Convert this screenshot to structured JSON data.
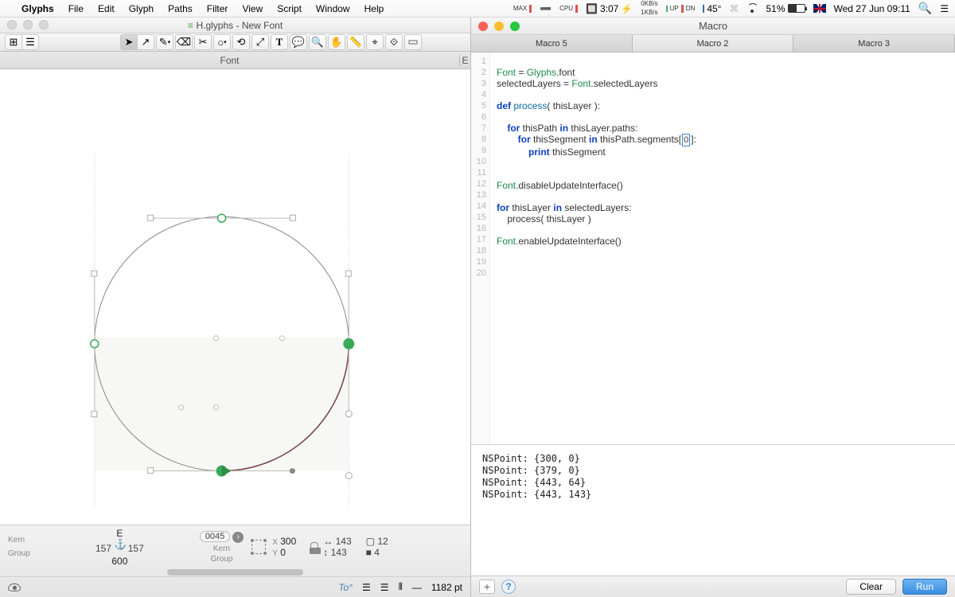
{
  "menubar": {
    "app": "Glyphs",
    "items": [
      "File",
      "Edit",
      "Glyph",
      "Paths",
      "Filter",
      "View",
      "Script",
      "Window",
      "Help"
    ],
    "net_up": "0KB/s",
    "net_down": "1KB/s",
    "time1": "3:07",
    "temp": "45°",
    "batt": "51%",
    "date": "Wed 27 Jun  09:11"
  },
  "glyphs": {
    "title": "H.glyphs - New Font",
    "titlebar_marker": "≡",
    "tab": "Font",
    "tab_right": "E",
    "info": {
      "glyph": "E",
      "unicode": "0045",
      "kern": "Kern",
      "kern_l": "157",
      "kern_r": "157",
      "group": "Group",
      "width": "600",
      "x": "X",
      "x_val": "300",
      "y": "Y",
      "y_val": "0",
      "dx": "143",
      "dy": "143",
      "w": "12",
      "h": "4"
    },
    "status": {
      "zoom": "1182 pt",
      "to": "To"
    }
  },
  "macro": {
    "title": "Macro",
    "tabs": [
      "Macro 5",
      "Macro 2",
      "Macro 3"
    ],
    "output": "NSPoint: {300, 0}\nNSPoint: {379, 0}\nNSPoint: {443, 64}\nNSPoint: {443, 143}",
    "clear": "Clear",
    "run": "Run",
    "plus": "+",
    "help": "?"
  },
  "code": {
    "l1": "Font = Glyphs.font",
    "l2": "selectedLayers = Font.selectedLayers",
    "l4": "def process( thisLayer ):",
    "l6": "    for thisPath in thisLayer.paths:",
    "l7a": "        for thisSegment in thisPath.segments[",
    "l7cur": "0",
    "l7b": "]:",
    "l8": "            print thisSegment",
    "l10": "Font.disableUpdateInterface()",
    "l12": "for thisLayer in selectedLayers:",
    "l13": "    process( thisLayer )",
    "l15": "Font.enableUpdateInterface()"
  }
}
